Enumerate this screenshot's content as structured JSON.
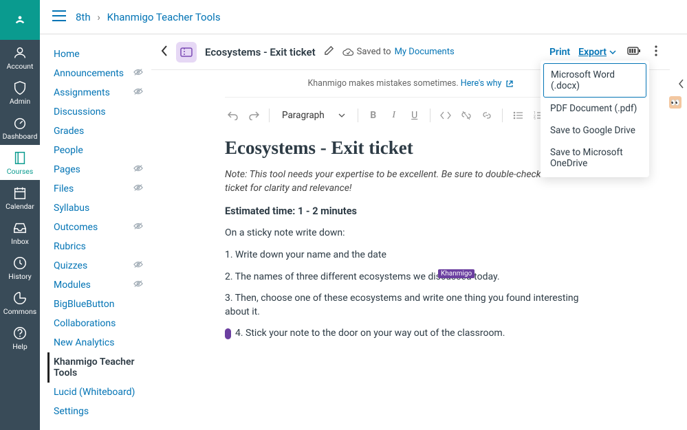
{
  "globalnav": [
    {
      "label": "Account",
      "icon": "user"
    },
    {
      "label": "Admin",
      "icon": "shield"
    },
    {
      "label": "Dashboard",
      "icon": "gauge"
    },
    {
      "label": "Courses",
      "icon": "book",
      "active": true
    },
    {
      "label": "Calendar",
      "icon": "calendar"
    },
    {
      "label": "Inbox",
      "icon": "inbox"
    },
    {
      "label": "History",
      "icon": "clock"
    },
    {
      "label": "Commons",
      "icon": "commons"
    },
    {
      "label": "Help",
      "icon": "help"
    }
  ],
  "breadcrumb": {
    "course": "8th",
    "tool": "Khanmigo Teacher Tools"
  },
  "coursenav": [
    {
      "label": "Home"
    },
    {
      "label": "Announcements",
      "hidden": true
    },
    {
      "label": "Assignments",
      "hidden": true
    },
    {
      "label": "Discussions"
    },
    {
      "label": "Grades"
    },
    {
      "label": "People"
    },
    {
      "label": "Pages",
      "hidden": true
    },
    {
      "label": "Files",
      "hidden": true
    },
    {
      "label": "Syllabus"
    },
    {
      "label": "Outcomes",
      "hidden": true
    },
    {
      "label": "Rubrics"
    },
    {
      "label": "Quizzes",
      "hidden": true
    },
    {
      "label": "Modules",
      "hidden": true
    },
    {
      "label": "BigBlueButton"
    },
    {
      "label": "Collaborations"
    },
    {
      "label": "New Analytics"
    },
    {
      "label": "Khanmigo Teacher Tools",
      "active": true
    },
    {
      "label": "Lucid (Whiteboard)"
    },
    {
      "label": "Settings"
    }
  ],
  "docHeader": {
    "title": "Ecosystems - Exit ticket",
    "savedText": "Saved to",
    "savedLink": "My Documents",
    "printLabel": "Print",
    "exportLabel": "Export"
  },
  "infoBar": {
    "text": "Khanmigo makes mistakes sometimes.",
    "link": "Here's why"
  },
  "formatSelect": "Paragraph",
  "exportMenu": [
    "Microsoft Word (.docx)",
    "PDF Document (.pdf)",
    "Save to Google Drive",
    "Save to Microsoft OneDrive"
  ],
  "document": {
    "heading": "Ecosystems - Exit ticket",
    "note": "Note: This tool needs your expertise to be excellent. Be sure to double-check this exit ticket for clarity and relevance!",
    "estimated": "Estimated time: 1 - 2 minutes",
    "intro": "On a sticky note write down:",
    "items": [
      "1. Write down your name and the date",
      "2. The names of three different ecosystems we discussed today.",
      "3. Then, choose one of these ecosystems and write one thing you found interesting about it.",
      "4. Stick your note to the door on your way out of the classroom."
    ],
    "tag": "Khanmigo"
  }
}
